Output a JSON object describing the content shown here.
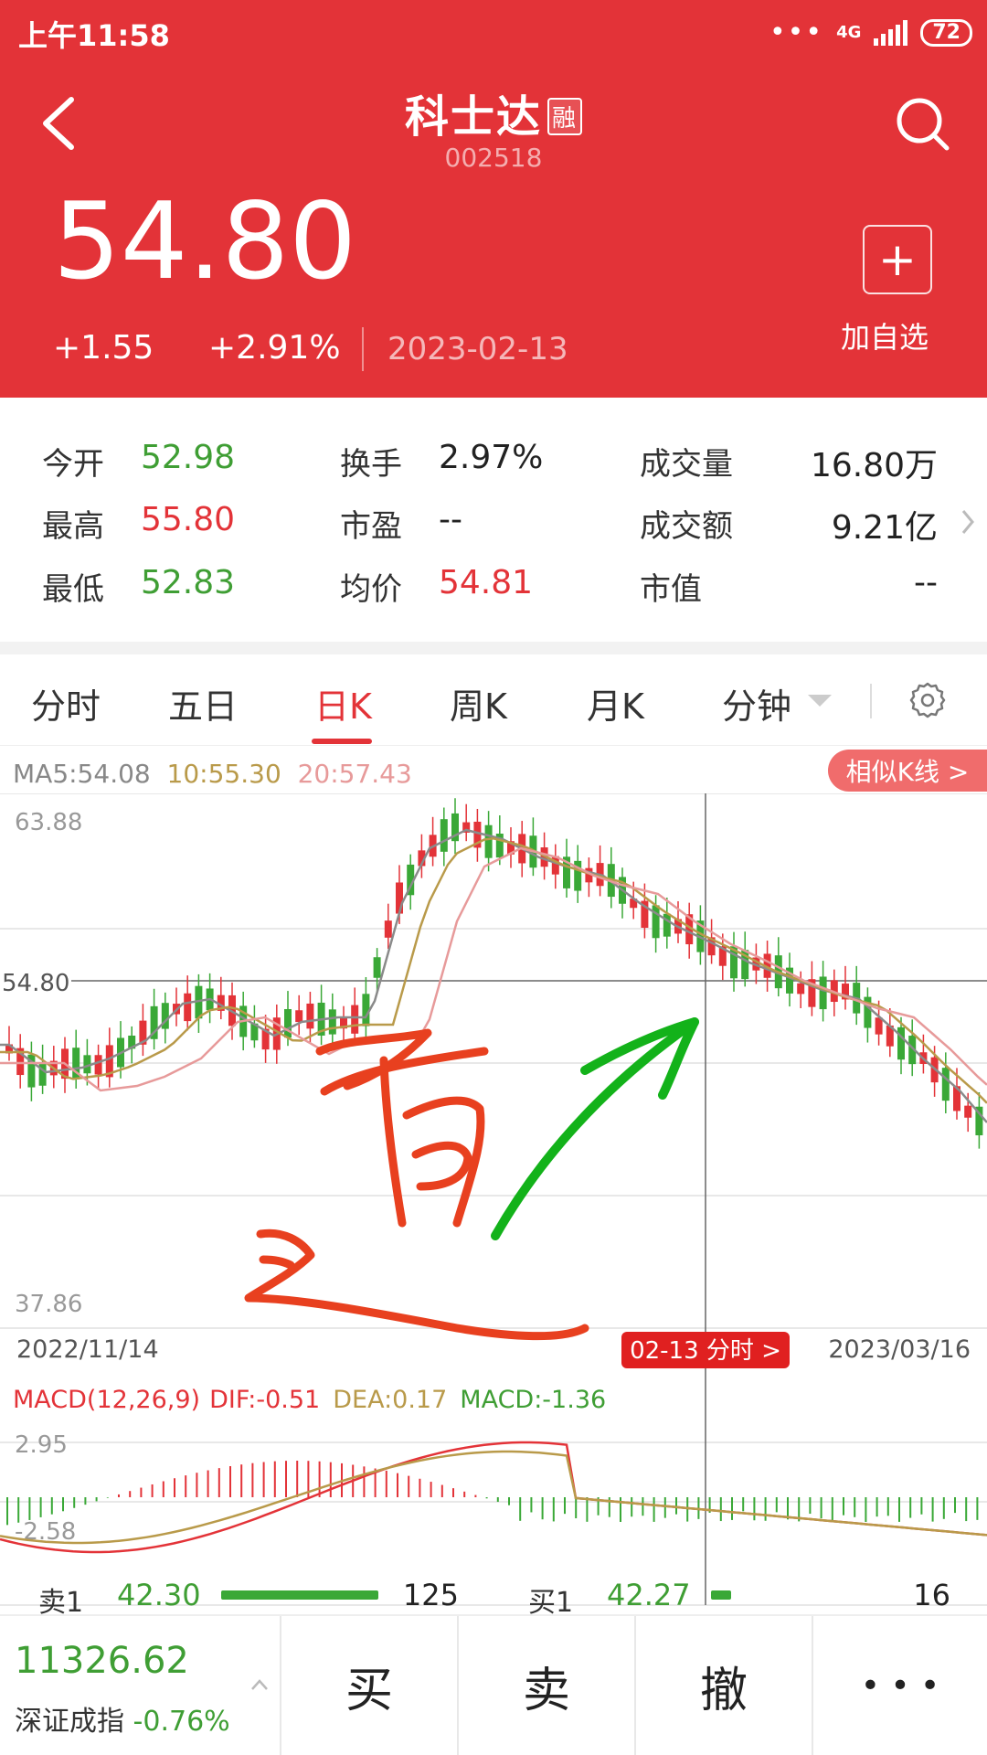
{
  "status": {
    "time": "上午11:58",
    "network": "4G",
    "battery": "72"
  },
  "header": {
    "title": "科士达",
    "margin_tag": "融",
    "code": "002518",
    "price": "54.80",
    "change": "+1.55",
    "change_pct": "+2.91%",
    "date": "2023-02-13",
    "add_label": "加自选"
  },
  "quote": [
    {
      "label": "今开",
      "value": "52.98",
      "color": "#3f9e34"
    },
    {
      "label": "最高",
      "value": "55.80",
      "color": "#e33338"
    },
    {
      "label": "最低",
      "value": "52.83",
      "color": "#3f9e34"
    },
    {
      "label": "换手",
      "value": "2.97%",
      "color": "#222222"
    },
    {
      "label": "市盈",
      "value": "--",
      "color": "#222222"
    },
    {
      "label": "均价",
      "value": "54.81",
      "color": "#e33338"
    },
    {
      "label": "成交量",
      "value": "16.80万",
      "color": "#222222"
    },
    {
      "label": "成交额",
      "value": "9.21亿",
      "color": "#222222"
    },
    {
      "label": "市值",
      "value": "--",
      "color": "#222222"
    }
  ],
  "tabs": {
    "intraday": "分时",
    "five_day": "五日",
    "day_k": "日K",
    "week_k": "周K",
    "month_k": "月K",
    "minute": "分钟",
    "active": "日K"
  },
  "kline": {
    "ma5": "MA5:54.08",
    "ma10": "10:55.30",
    "ma20": "20:57.43",
    "similar_btn": "相似K线 >",
    "y_top": "63.88",
    "y_bottom": "37.86",
    "cursor_price": "54.80",
    "date_start": "2022/11/14",
    "date_end": "2023/03/16",
    "cursor_tag": "02-13 分时 >"
  },
  "macd": {
    "title": "MACD(12,26,9)",
    "dif": "DIF:-0.51",
    "dea": "DEA:0.17",
    "macd": "MACD:-1.36",
    "y_top": "2.95",
    "y_bottom": "-2.58"
  },
  "orderbook": {
    "sell_label": "卖1",
    "sell_price": "42.30",
    "sell_vol": "125",
    "sell_fill": 1.0,
    "buy_label": "买1",
    "buy_price": "42.27",
    "buy_vol": "16",
    "buy_fill": 0.13
  },
  "footer": {
    "index_value": "11326.62",
    "index_name": "深证成指",
    "index_change": "-0.76%",
    "buy": "买",
    "sell": "卖",
    "cancel": "撤",
    "more": "• • •"
  },
  "handwriting": "逌",
  "colors": {
    "up": "#e33338",
    "down": "#3f9e34",
    "header_bg": "#e33338",
    "ma5": "#8a8a8a",
    "ma10": "#b99a4a",
    "ma20": "#e79a9a"
  }
}
